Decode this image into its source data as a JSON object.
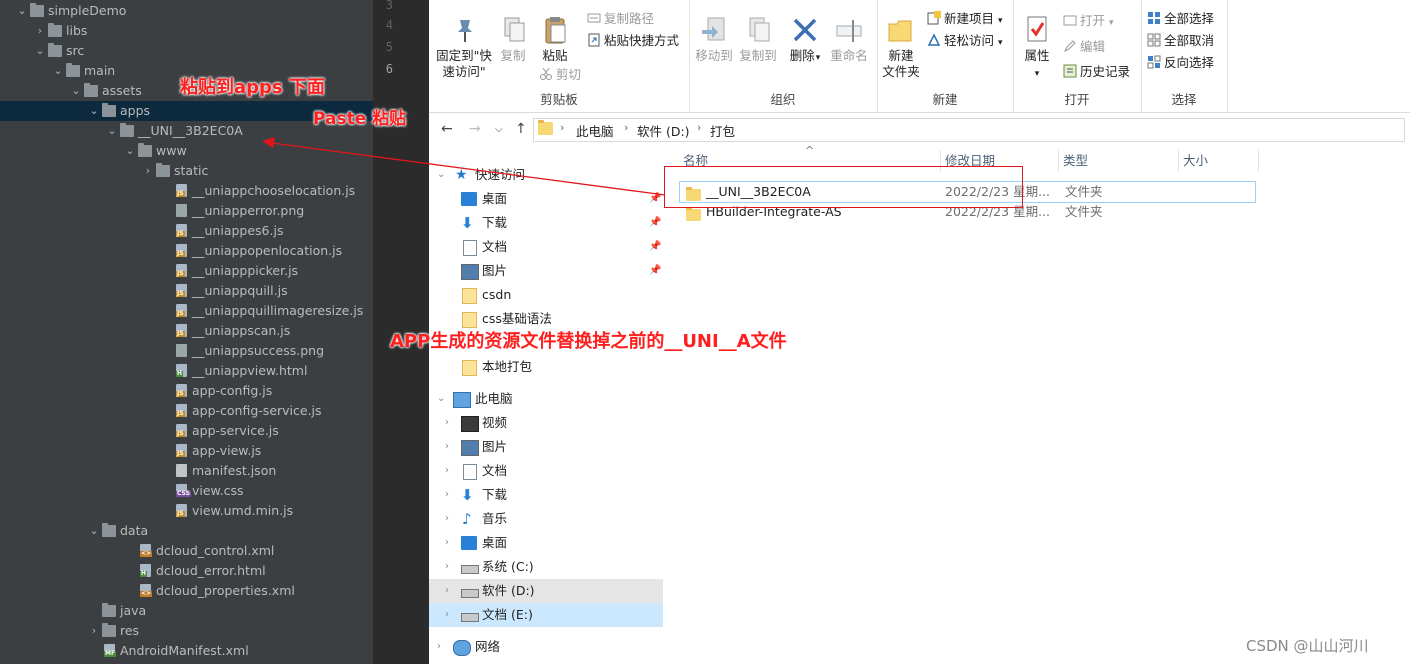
{
  "ide": {
    "line_numbers": [
      "3",
      "4",
      "5",
      "6"
    ],
    "tree": [
      {
        "label": "simpleDemo",
        "kind": "folder",
        "depth": 0,
        "expanded": true
      },
      {
        "label": "libs",
        "kind": "folder",
        "depth": 1,
        "expanded": false
      },
      {
        "label": "src",
        "kind": "folder",
        "depth": 1,
        "expanded": true
      },
      {
        "label": "main",
        "kind": "folder",
        "depth": 2,
        "expanded": true
      },
      {
        "label": "assets",
        "kind": "folder",
        "depth": 3,
        "expanded": true
      },
      {
        "label": "apps",
        "kind": "folder",
        "depth": 4,
        "expanded": true,
        "selected": true
      },
      {
        "label": "__UNI__3B2EC0A",
        "kind": "folder",
        "depth": 5,
        "expanded": true
      },
      {
        "label": "www",
        "kind": "folder",
        "depth": 6,
        "expanded": true
      },
      {
        "label": "static",
        "kind": "folder",
        "depth": 7,
        "expanded": false
      },
      {
        "label": "__uniappchooselocation.js",
        "kind": "js",
        "depth": 8
      },
      {
        "label": "__uniapperror.png",
        "kind": "png",
        "depth": 8
      },
      {
        "label": "__uniappes6.js",
        "kind": "js",
        "depth": 8
      },
      {
        "label": "__uniappopenlocation.js",
        "kind": "js",
        "depth": 8
      },
      {
        "label": "__uniapppicker.js",
        "kind": "js",
        "depth": 8
      },
      {
        "label": "__uniappquill.js",
        "kind": "js",
        "depth": 8
      },
      {
        "label": "__uniappquillimageresize.js",
        "kind": "js",
        "depth": 8
      },
      {
        "label": "__uniappscan.js",
        "kind": "js",
        "depth": 8
      },
      {
        "label": "__uniappsuccess.png",
        "kind": "png",
        "depth": 8
      },
      {
        "label": "__uniappview.html",
        "kind": "html",
        "depth": 8
      },
      {
        "label": "app-config.js",
        "kind": "js",
        "depth": 8
      },
      {
        "label": "app-config-service.js",
        "kind": "js",
        "depth": 8
      },
      {
        "label": "app-service.js",
        "kind": "js",
        "depth": 8
      },
      {
        "label": "app-view.js",
        "kind": "js",
        "depth": 8
      },
      {
        "label": "manifest.json",
        "kind": "json",
        "depth": 8
      },
      {
        "label": "view.css",
        "kind": "css",
        "depth": 8
      },
      {
        "label": "view.umd.min.js",
        "kind": "js",
        "depth": 8
      },
      {
        "label": "data",
        "kind": "folder",
        "depth": 4,
        "expanded": true
      },
      {
        "label": "dcloud_control.xml",
        "kind": "xml",
        "depth": 6
      },
      {
        "label": "dcloud_error.html",
        "kind": "html",
        "depth": 6
      },
      {
        "label": "dcloud_properties.xml",
        "kind": "xml",
        "depth": 6
      },
      {
        "label": "java",
        "kind": "folder",
        "depth": 4,
        "expanded": null
      },
      {
        "label": "res",
        "kind": "folder",
        "depth": 4,
        "expanded": false
      },
      {
        "label": "AndroidManifest.xml",
        "kind": "mf",
        "depth": 4
      }
    ]
  },
  "ribbon": {
    "clipboard": {
      "pin_label_1": "固定到\"快",
      "pin_label_2": "速访问\"",
      "copy_label": "复制",
      "paste_label": "粘贴",
      "copy_path": "复制路径",
      "paste_shortcut": "粘贴快捷方式",
      "cut": "剪切",
      "title": "剪贴板"
    },
    "organize": {
      "move_to": "移动到",
      "copy_to": "复制到",
      "delete": "删除",
      "rename": "重命名",
      "title": "组织"
    },
    "new": {
      "new_folder_1": "新建",
      "new_folder_2": "文件夹",
      "new_item": "新建项目",
      "easy_access": "轻松访问",
      "title": "新建"
    },
    "open": {
      "properties": "属性",
      "open": "打开",
      "edit": "编辑",
      "history": "历史记录",
      "title": "打开"
    },
    "select": {
      "select_all": "全部选择",
      "select_none": "全部取消",
      "invert": "反向选择",
      "title": "选择"
    }
  },
  "address": {
    "crumbs": [
      "此电脑",
      "软件 (D:)",
      "打包"
    ]
  },
  "nav": {
    "quick_access": "快速访问",
    "desktop": "桌面",
    "downloads": "下载",
    "documents": "文档",
    "pictures": "图片",
    "csdn": "csdn",
    "css_basics": "css基础语法",
    "local_pack": "本地打包",
    "this_pc": "此电脑",
    "videos": "视频",
    "pictures2": "图片",
    "documents2": "文档",
    "downloads2": "下载",
    "music": "音乐",
    "desktop2": "桌面",
    "drive_c": "系统 (C:)",
    "drive_d": "软件 (D:)",
    "drive_e": "文档 (E:)",
    "network": "网络"
  },
  "files": {
    "columns": [
      "名称",
      "修改日期",
      "类型",
      "大小"
    ],
    "rows": [
      {
        "name": "__UNI__3B2EC0A",
        "date": "2022/2/23 星期...",
        "type": "文件夹"
      },
      {
        "name": "HBuilder-Integrate-AS",
        "date": "2022/2/23 星期...",
        "type": "文件夹"
      }
    ]
  },
  "annotations": {
    "paste_under_apps": "粘贴到apps 下面",
    "paste": "Paste 粘贴",
    "replace_note": "APP生成的资源文件替换掉之前的__UNI__A文件",
    "color": "#ff1f1f"
  },
  "watermark": "CSDN @山山河川"
}
